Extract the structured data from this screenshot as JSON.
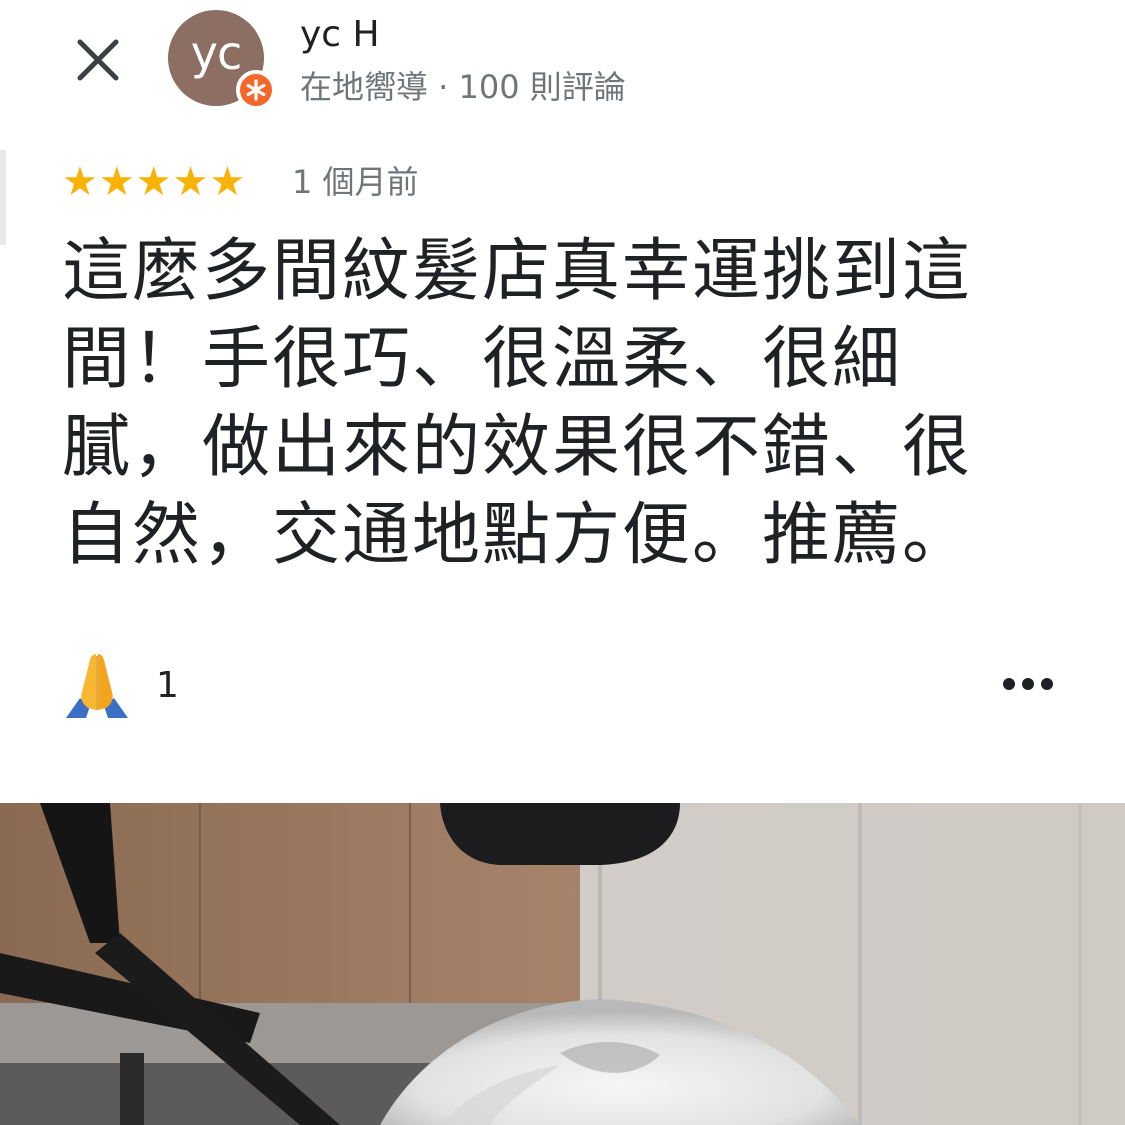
{
  "header": {
    "close_icon": "close-icon",
    "avatar_initials": "yc",
    "avatar_color": "#8d6e63",
    "badge_icon": "local-guide-star-icon",
    "badge_color": "#f4672a",
    "author_name": "yc H",
    "author_meta": "在地嚮導 · 100 則評論"
  },
  "review": {
    "rating": 5,
    "star_color": "#f9b307",
    "date": "1 個月前",
    "text": "這麼多間紋髮店真幸運挑到這間！手很巧、很溫柔、很細膩，做出來的效果很不錯、很自然，交通地點方便。推薦。"
  },
  "reaction": {
    "icon": "folded-hands-icon",
    "count": "1"
  },
  "menu": {
    "icon": "more-horizontal-icon"
  },
  "photo": {
    "subject": "review-photo"
  }
}
